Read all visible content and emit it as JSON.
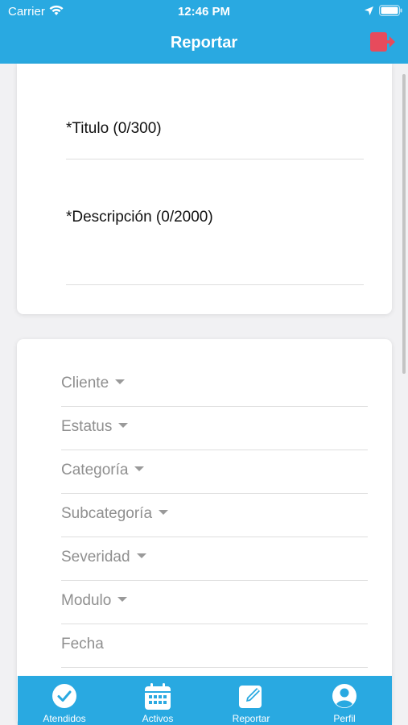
{
  "status_bar": {
    "carrier": "Carrier",
    "time": "12:46 PM"
  },
  "header": {
    "title": "Reportar"
  },
  "form": {
    "title_field": {
      "label": "*Titulo (0/300)"
    },
    "description_field": {
      "label": "*Descripción (0/2000)"
    }
  },
  "filters": [
    {
      "label": "Cliente",
      "has_dropdown": true
    },
    {
      "label": "Estatus",
      "has_dropdown": true
    },
    {
      "label": "Categoría",
      "has_dropdown": true
    },
    {
      "label": "Subcategoría",
      "has_dropdown": true
    },
    {
      "label": "Severidad",
      "has_dropdown": true
    },
    {
      "label": "Modulo",
      "has_dropdown": true
    },
    {
      "label": "Fecha",
      "has_dropdown": false
    }
  ],
  "tabs": [
    {
      "label": "Atendidos",
      "icon": "check-circle-icon"
    },
    {
      "label": "Activos",
      "icon": "calendar-icon"
    },
    {
      "label": "Reportar",
      "icon": "edit-icon"
    },
    {
      "label": "Perfil",
      "icon": "user-icon"
    }
  ],
  "colors": {
    "primary": "#29a9e1",
    "logout": "#e74b5c",
    "placeholder": "#8f8f8f"
  }
}
